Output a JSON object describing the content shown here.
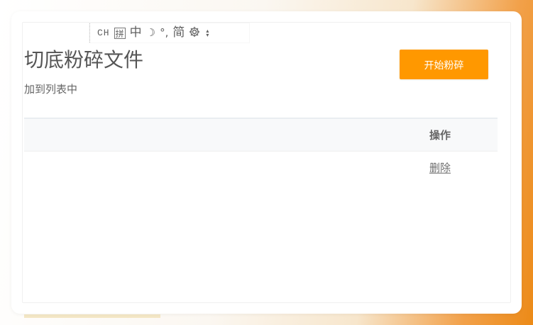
{
  "ime": {
    "mode_text": "CH",
    "pinyin_box": "拼",
    "chinese": "中",
    "moon": "☽",
    "punctuation": "°,",
    "simplified": "简",
    "settings_icon": "gear-icon",
    "arrows": [
      "▴",
      "▾"
    ]
  },
  "page": {
    "title": "切底粉碎文件",
    "subtitle": "加到列表中",
    "start_button": "开始粉碎"
  },
  "table": {
    "header_action": "操作",
    "row_action": "删除"
  },
  "colors": {
    "accent": "#ff9800"
  }
}
